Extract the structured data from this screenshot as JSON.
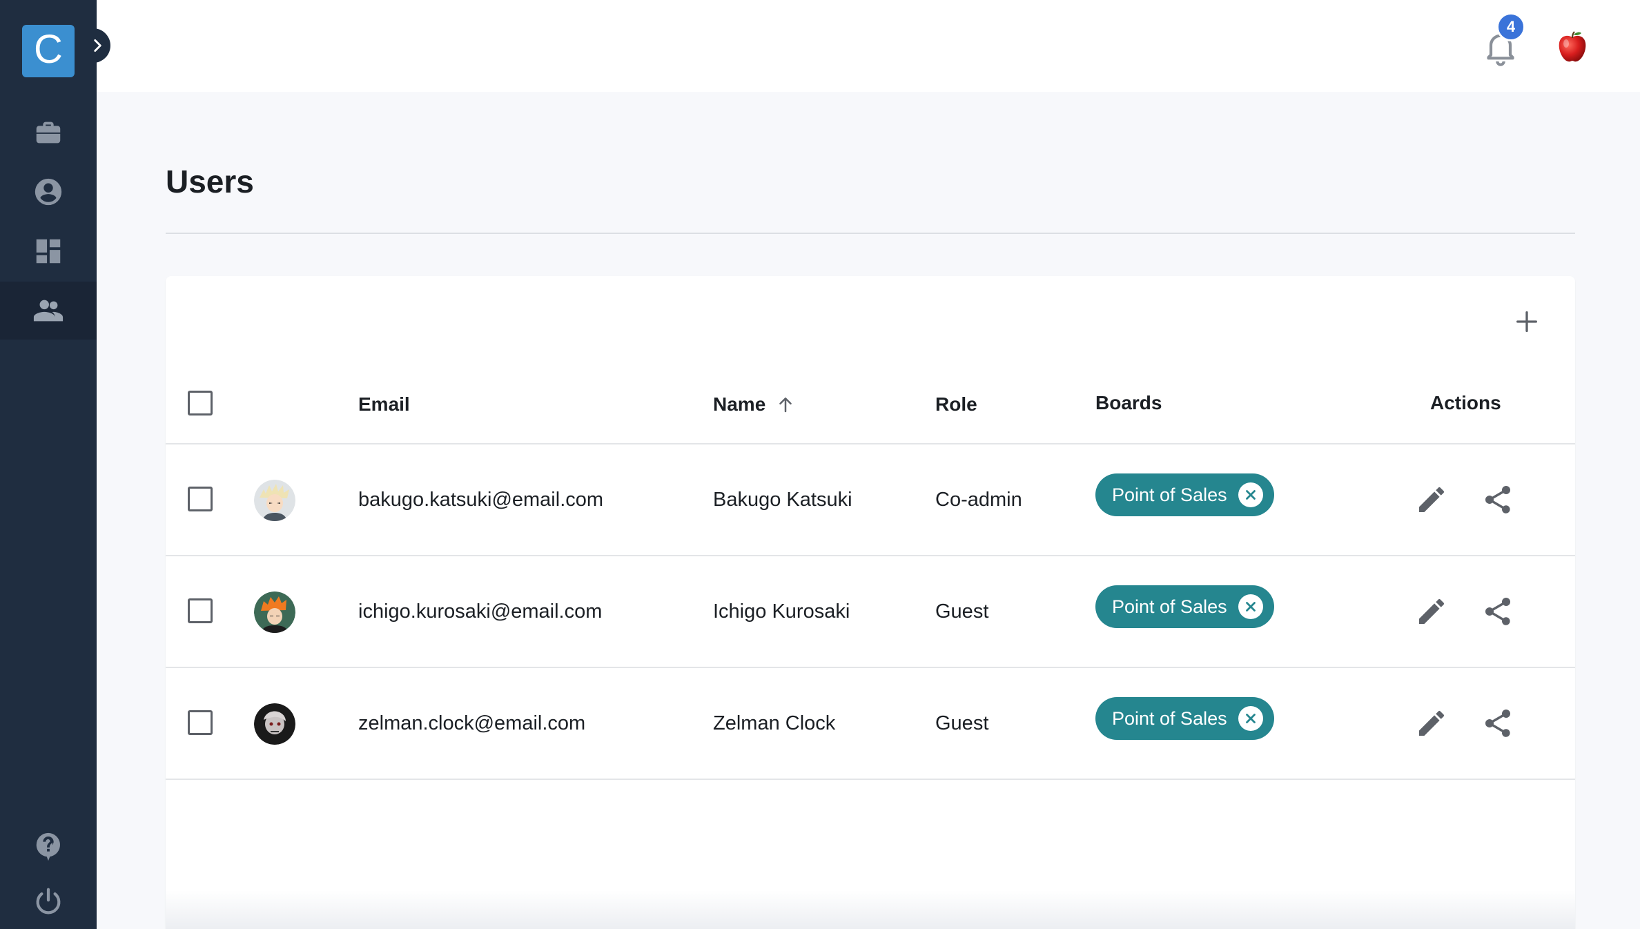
{
  "app": {
    "logo_letter": "C"
  },
  "topbar": {
    "notifications_count": "4"
  },
  "page": {
    "title": "Users"
  },
  "table": {
    "columns": {
      "email": "Email",
      "name": "Name",
      "role": "Role",
      "boards": "Boards",
      "actions": "Actions"
    },
    "sort": {
      "column": "name",
      "direction": "ascending"
    },
    "rows": [
      {
        "email": "bakugo.katsuki@email.com",
        "name": "Bakugo Katsuki",
        "role": "Co-admin",
        "board": "Point of Sales"
      },
      {
        "email": "ichigo.kurosaki@email.com",
        "name": "Ichigo Kurosaki",
        "role": "Guest",
        "board": "Point of Sales"
      },
      {
        "email": "zelman.clock@email.com",
        "name": "Zelman Clock",
        "role": "Guest",
        "board": "Point of Sales"
      }
    ]
  },
  "colors": {
    "sidebar": "#1f2d40",
    "accent": "#3b8fd0",
    "chip": "#25868f",
    "badge": "#3a73d9"
  },
  "icons": [
    "briefcase-icon",
    "account-circle-icon",
    "dashboard-icon",
    "people-icon",
    "help-icon",
    "power-icon",
    "bell-icon",
    "plus-icon",
    "pencil-icon",
    "share-icon",
    "close-circle-icon",
    "arrow-up-icon",
    "chevron-right-icon"
  ]
}
